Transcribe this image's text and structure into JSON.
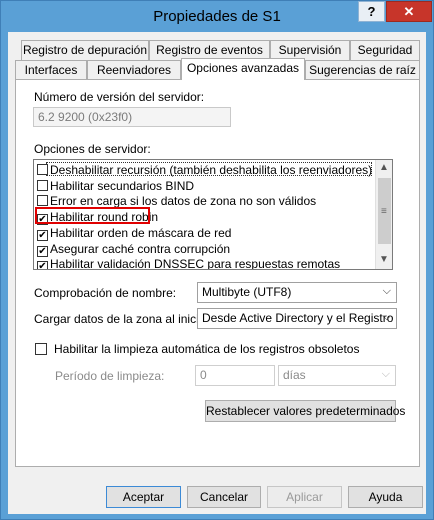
{
  "window": {
    "title": "Propiedades de S1",
    "help_glyph": "?",
    "close_glyph": "✕"
  },
  "tabs": {
    "row1": [
      "Registro de depuración",
      "Registro de eventos",
      "Supervisión",
      "Seguridad"
    ],
    "row2": [
      "Interfaces",
      "Reenviadores",
      "Opciones avanzadas",
      "Sugerencias de raíz"
    ],
    "active": "Opciones avanzadas"
  },
  "version": {
    "label": "Número de versión del servidor:",
    "value": "6.2 9200 (0x23f0)"
  },
  "options": {
    "label": "Opciones de servidor:",
    "items": [
      {
        "label": "Deshabilitar recursión (también deshabilita los reenviadores)",
        "checked": false
      },
      {
        "label": "Habilitar secundarios BIND",
        "checked": false
      },
      {
        "label": "Error en carga si los datos de zona no son válidos",
        "checked": false
      },
      {
        "label": "Habilitar round robin",
        "checked": true
      },
      {
        "label": "Habilitar orden de máscara de red",
        "checked": true
      },
      {
        "label": "Asegurar caché contra corrupción",
        "checked": true
      },
      {
        "label": "Habilitar validación DNSSEC para respuestas remotas",
        "checked": true
      }
    ]
  },
  "name_check": {
    "label": "Comprobación de nombre:",
    "value": "Multibyte (UTF8)"
  },
  "zone_load": {
    "label": "Cargar datos de la zona al iniciar:",
    "value": "Desde Active Directory y el Registro"
  },
  "scavenging": {
    "label": "Habilitar la limpieza automática de los registros obsoletos",
    "checked": false,
    "period_label": "Período de limpieza:",
    "period_value": "0",
    "unit": "días"
  },
  "reset_label": "Restablecer valores predeterminados",
  "buttons": {
    "ok": "Aceptar",
    "cancel": "Cancelar",
    "apply": "Aplicar",
    "help": "Ayuda"
  }
}
